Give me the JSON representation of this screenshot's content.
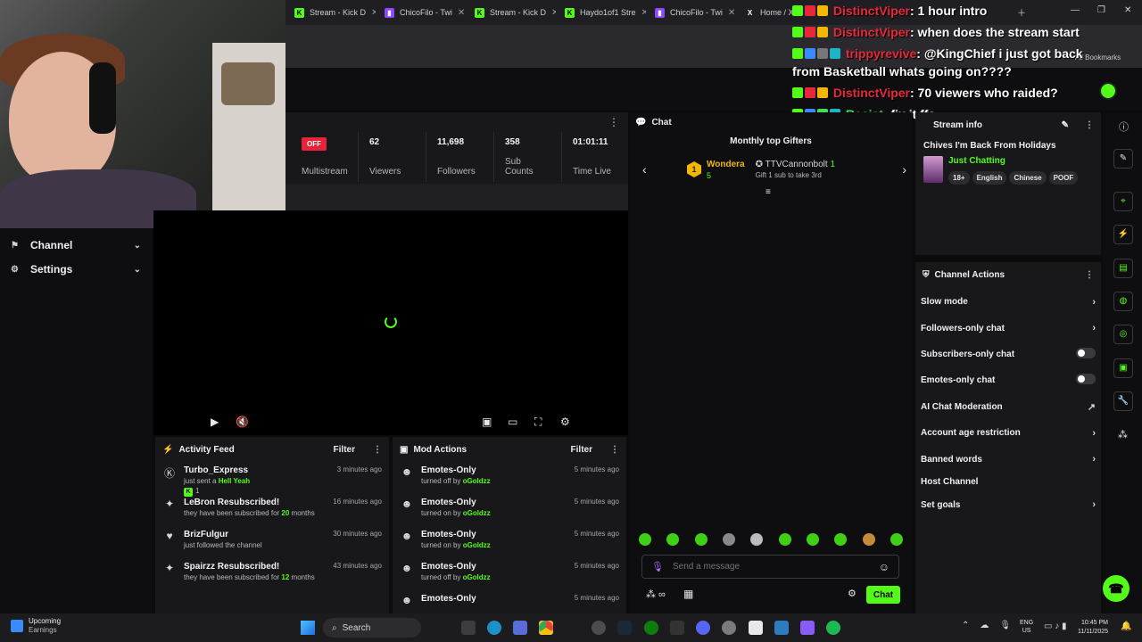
{
  "browser": {
    "tabs": [
      {
        "label": "Stream - Kick D",
        "color": "#53fc18",
        "glyph": "K"
      },
      {
        "label": "ChicoFilo - Twi",
        "color": "#9146ff",
        "glyph": "▮"
      },
      {
        "label": "Stream - Kick D",
        "color": "#53fc18",
        "glyph": "K"
      },
      {
        "label": "Haydo1of1 Stre",
        "color": "#53fc18",
        "glyph": "K"
      },
      {
        "label": "ChicoFilo - Twi",
        "color": "#9146ff",
        "glyph": "▮"
      },
      {
        "label": "Home / X",
        "color": "#ffffff",
        "glyph": "X"
      }
    ],
    "bookmarks_label": "All Bookmarks"
  },
  "overlay_chat": [
    {
      "name": "DistinctViper",
      "text": ": 1 hour intro"
    },
    {
      "name": "DistinctViper",
      "text": ": when does the stream start"
    },
    {
      "name": "trippyrevive",
      "text": ": @KingChief i just got back from Basketball whats going on????"
    },
    {
      "name": "DistinctViper",
      "text": ": 70 viewers who raided?"
    },
    {
      "name": "Resist",
      "text": ": fix it ffs"
    }
  ],
  "leftnav": {
    "channel": "Channel",
    "settings": "Settings"
  },
  "stats": {
    "off_badge": "OFF",
    "multistream": "Multistream",
    "viewers_value": "62",
    "viewers_label": "Viewers",
    "followers_value": "11,698",
    "followers_label": "Followers",
    "subs_value": "358",
    "subs_label": "Sub Counts",
    "time_value": "01:01:11",
    "time_label": "Time Live"
  },
  "activity": {
    "title": "Activity Feed",
    "filter": "Filter",
    "items": [
      {
        "name": "Turbo_Express",
        "sub_pre": "just sent a ",
        "sub_hl": "Hell Yeah",
        "sub_post": "",
        "extra": "1",
        "time": "3 minutes ago"
      },
      {
        "name": "LeBron Resubscribed!",
        "sub_pre": "they have been subscribed for ",
        "sub_hl": "20",
        "sub_post": " months",
        "extra": "",
        "time": "16 minutes ago"
      },
      {
        "name": "BrizFulgur",
        "sub_pre": "just followed the channel",
        "sub_hl": "",
        "sub_post": "",
        "extra": "",
        "time": "30 minutes ago"
      },
      {
        "name": "Spairzz Resubscribed!",
        "sub_pre": "they have been subscribed for ",
        "sub_hl": "12",
        "sub_post": " months",
        "extra": "",
        "time": "43 minutes ago"
      }
    ]
  },
  "mod": {
    "title": "Mod Actions",
    "filter": "Filter",
    "items": [
      {
        "name": "Emotes-Only",
        "pre": "turned off by ",
        "by": "oGoldzz",
        "time": "5 minutes ago"
      },
      {
        "name": "Emotes-Only",
        "pre": "turned on by ",
        "by": "oGoldzz",
        "time": "5 minutes ago"
      },
      {
        "name": "Emotes-Only",
        "pre": "turned on by ",
        "by": "oGoldzz",
        "time": "5 minutes ago"
      },
      {
        "name": "Emotes-Only",
        "pre": "turned off by ",
        "by": "oGoldzz",
        "time": "5 minutes ago"
      },
      {
        "name": "Emotes-Only",
        "pre": "",
        "by": "",
        "time": "5 minutes ago"
      }
    ]
  },
  "chat": {
    "title": "Chat",
    "gifters_title": "Monthly top Gifters",
    "gifter1_name": "Wondera",
    "gifter1_count": "5",
    "gifter1_rank": "1",
    "gifter2_name": "TTVCannonbolt",
    "gifter2_count": "1",
    "gifter2_note": "Gift 1 sub to take 3rd",
    "input_placeholder": "Send a message",
    "send_label": "Chat"
  },
  "stream_info": {
    "title": "Stream info",
    "stream_title": "Chives I'm Back From Holidays",
    "category": "Just Chatting",
    "tags": [
      "18+",
      "English",
      "Chinese",
      "POOF"
    ]
  },
  "channel_actions": {
    "title": "Channel Actions",
    "rows": [
      {
        "label": "Slow mode",
        "kind": "chevron"
      },
      {
        "label": "Followers-only chat",
        "kind": "chevron"
      },
      {
        "label": "Subscribers-only chat",
        "kind": "toggle"
      },
      {
        "label": "Emotes-only chat",
        "kind": "toggle"
      },
      {
        "label": "AI Chat Moderation",
        "kind": "link"
      },
      {
        "label": "Account age restriction",
        "kind": "chevron"
      },
      {
        "label": "Banned words",
        "kind": "chevron"
      },
      {
        "label": "Host Channel",
        "kind": "none"
      },
      {
        "label": "Set goals",
        "kind": "chevron"
      }
    ]
  },
  "taskbar": {
    "weather_title": "Upcoming",
    "weather_sub": "Earnings",
    "search": "Search",
    "lang1": "ENG",
    "lang2": "US",
    "time": "10:45 PM",
    "date": "11/11/2025"
  },
  "colors": {
    "kick_green": "#53fc18",
    "offline_red": "#e5233a",
    "panel_bg": "#18181b"
  }
}
